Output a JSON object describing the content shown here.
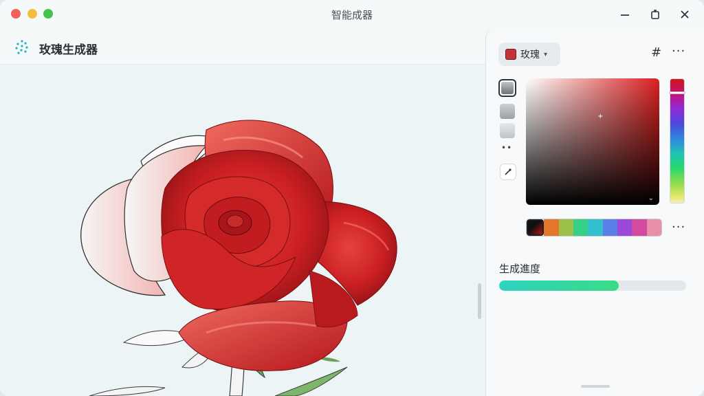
{
  "window": {
    "title": "智能成器",
    "minimize_icon": "minimize-icon",
    "restore_icon": "restore-icon",
    "close_icon": "close-icon"
  },
  "app": {
    "title": "玫瑰生成器",
    "logo_icon": "dotted-spiral-logo-icon"
  },
  "panel": {
    "color_select": {
      "label": "玫瑰",
      "swatch_color": "#c43337"
    },
    "grid_icon": "hash-grid-icon",
    "more_icon": "more-horizontal-icon",
    "tools": [
      {
        "name": "gradient-tool-dark",
        "selected": true
      },
      {
        "name": "gradient-tool-mid",
        "selected": false
      },
      {
        "name": "gradient-tool-light",
        "selected": false
      }
    ],
    "eyedropper_icon": "eyedropper-icon",
    "picker": {
      "hue_color": "#d9201f",
      "hue_position": 0.1
    },
    "palette": {
      "selected_index": 0,
      "colors": [
        "#111111",
        "#e5762c",
        "#9cc04a",
        "#36cf86",
        "#32bfd0",
        "#5b7fe6",
        "#9a49d8",
        "#d44aa0",
        "#e890a8"
      ]
    },
    "progress": {
      "label": "生成進度",
      "value": 0.64,
      "colors": [
        "#2fd2c0",
        "#3adb86"
      ]
    }
  }
}
